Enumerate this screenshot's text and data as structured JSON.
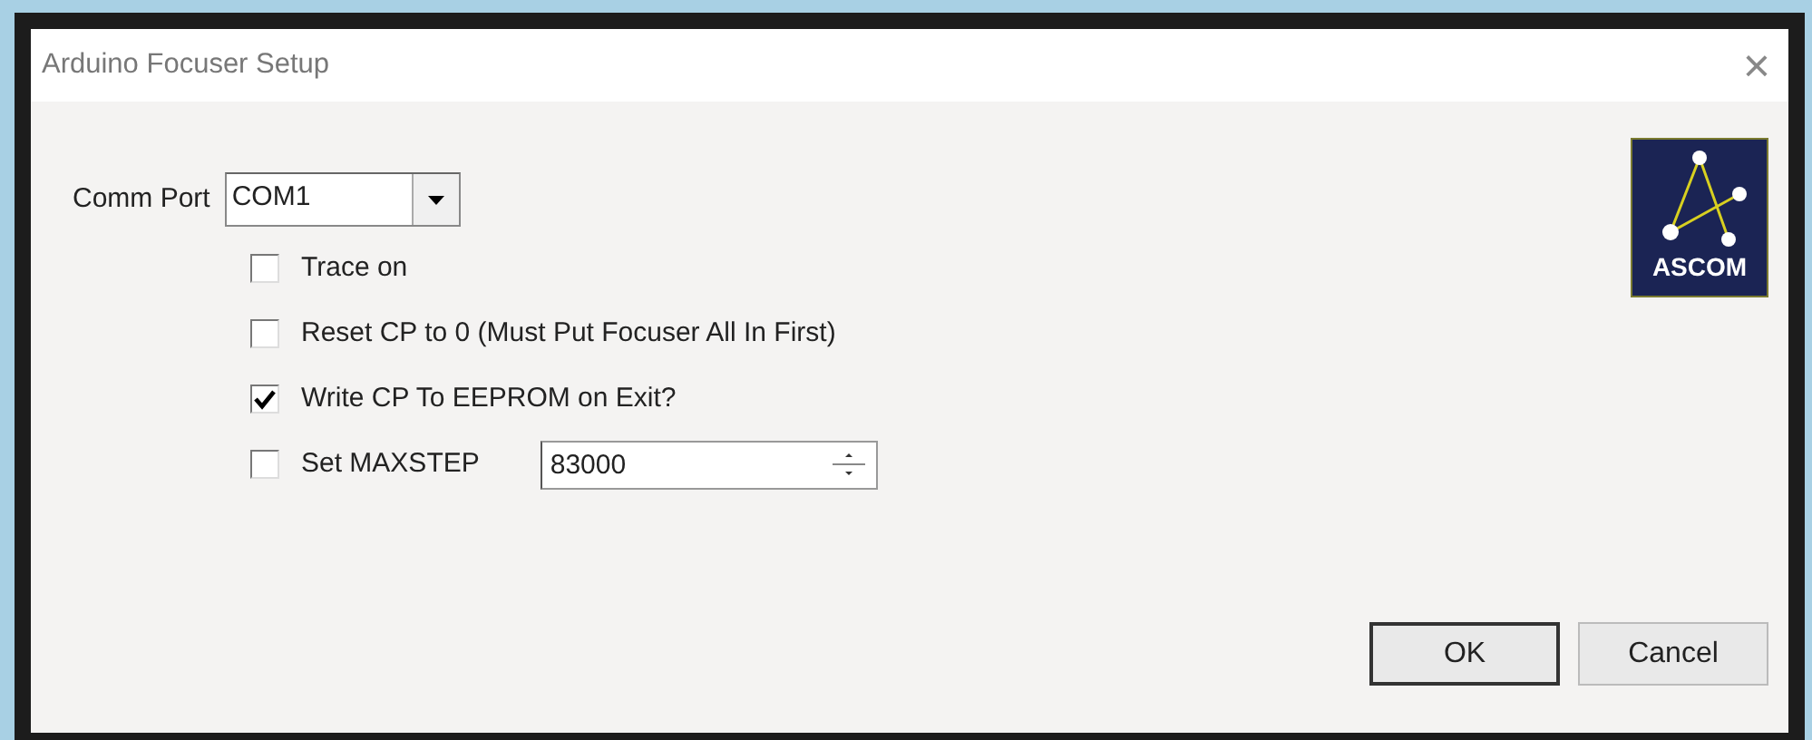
{
  "window": {
    "title": "Arduino Focuser Setup",
    "close": "×"
  },
  "comm_port": {
    "label": "Comm Port",
    "value": "COM1"
  },
  "options": [
    {
      "kind": "checkbox",
      "label": "Trace on",
      "checked": false
    },
    {
      "kind": "checkbox",
      "label": "Reset CP to 0  (Must Put Focuser All In First)",
      "checked": false
    },
    {
      "kind": "checkbox",
      "label": "Write CP To EEPROM on Exit?",
      "checked": true
    },
    {
      "kind": "spin",
      "label": "Set MAXSTEP",
      "checked": false,
      "value": "83000"
    }
  ],
  "logo": {
    "text": "ASCOM"
  },
  "buttons": [
    {
      "label": "OK",
      "default": true
    },
    {
      "label": "Cancel",
      "default": false
    }
  ]
}
